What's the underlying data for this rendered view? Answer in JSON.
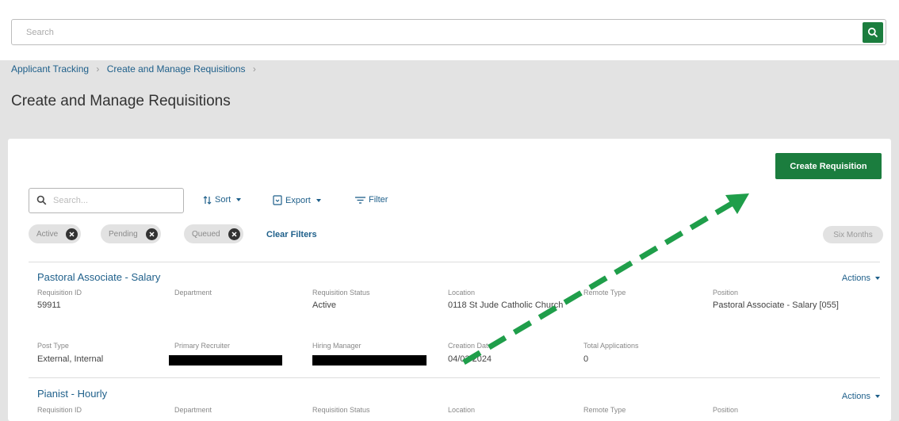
{
  "search": {
    "placeholder": "Search"
  },
  "breadcrumb": {
    "items": [
      "Applicant Tracking",
      "Create and Manage Requisitions"
    ]
  },
  "page_title": "Create and Manage Requisitions",
  "toolbar": {
    "create_label": "Create Requisition",
    "search_placeholder": "Search...",
    "sort_label": "Sort",
    "export_label": "Export",
    "filter_label": "Filter"
  },
  "filters": {
    "chips": [
      "Active",
      "Pending",
      "Queued"
    ],
    "clear_label": "Clear Filters",
    "range_label": "Six Months"
  },
  "labels": {
    "requisition_id": "Requisition ID",
    "department": "Department",
    "requisition_status": "Requisition Status",
    "location": "Location",
    "remote_type": "Remote Type",
    "position": "Position",
    "post_type": "Post Type",
    "primary_recruiter": "Primary Recruiter",
    "hiring_manager": "Hiring Manager",
    "creation_date": "Creation Date",
    "total_applications": "Total Applications",
    "actions": "Actions"
  },
  "requisitions": [
    {
      "title": "Pastoral Associate - Salary",
      "requisition_id": "59911",
      "department": "",
      "status": "Active",
      "location": "0118 St Jude Catholic Church",
      "remote_type": "",
      "position": "Pastoral Associate - Salary [055]",
      "post_type": "External, Internal",
      "creation_date": "04/03/2024",
      "total_applications": "0"
    },
    {
      "title": "Pianist - Hourly"
    }
  ],
  "colors": {
    "accent": "#1b7d3e",
    "link": "#1e5f8a",
    "arrow": "#1f9e4a"
  },
  "icons": {
    "search": "search-icon",
    "sort": "sort-icon",
    "export": "export-icon",
    "filter": "filter-icon",
    "remove": "close-circle-icon",
    "caret": "caret-down-icon"
  }
}
